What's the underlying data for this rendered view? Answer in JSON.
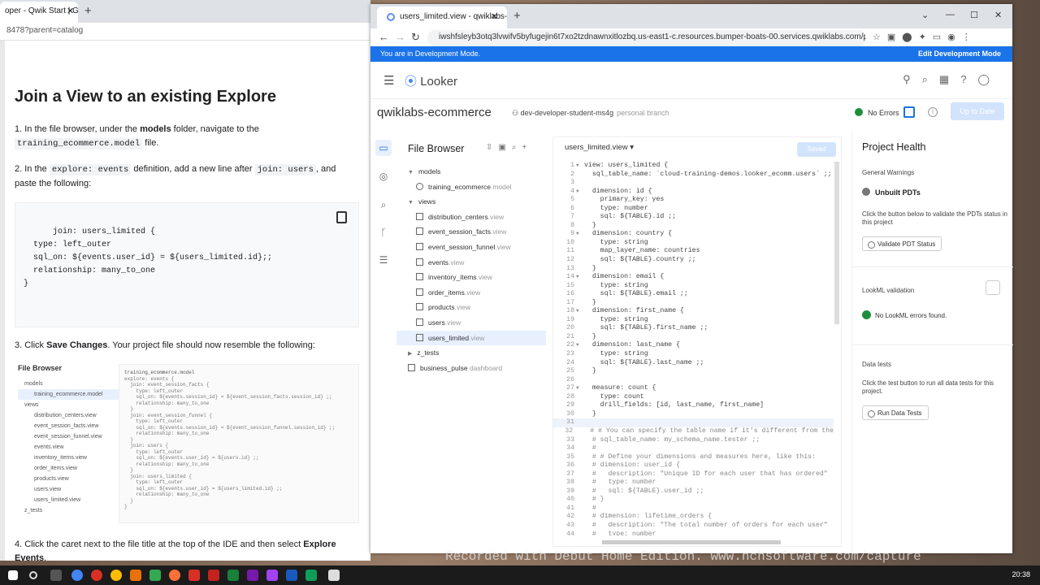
{
  "left_window": {
    "tab_title": "oper - Qwik Start | G",
    "url": "8478?parent=catalog",
    "heading": "Join a View to an existing Explore",
    "step1": {
      "a": "1. In the file browser, under the ",
      "b": "models",
      "c": " folder, navigate to the ",
      "code": "training_ecommerce.model",
      "d": " file."
    },
    "step2": {
      "a": "2. In the ",
      "code1": "explore: events",
      "b": " definition, add a new line after ",
      "code2": "join: users",
      "c": ", and paste the following:"
    },
    "code_block": "join: users_limited {\n  type: left_outer\n  sql_on: ${events.user_id} = ${users_limited.id};;\n  relationship: many_to_one\n}",
    "step3": {
      "a": "3. Click ",
      "b": "Save Changes",
      "c": ". Your project file should now resemble the following:"
    },
    "thumb": {
      "title": "File Browser",
      "file": "training_ecommerce.model",
      "items": [
        "models",
        "training_ecommerce.model",
        "views",
        "distribution_centers.view",
        "event_session_facts.view",
        "event_session_funnel.view",
        "events.view",
        "inventory_items.view",
        "order_items.view",
        "products.view",
        "users.view",
        "users_limited.view",
        "z_tests"
      ],
      "code": "explore: events {\n  join: event_session_facts {\n    type: left_outer\n    sql_on: ${events.session_id} = ${event_session_facts.session_id} ;;\n    relationship: many_to_one\n  }\n  join: event_session_funnel {\n    type: left_outer\n    sql_on: ${events.session_id} = ${event_session_funnel.session_id} ;;\n    relationship: many_to_one\n  }\n  join: users {\n    type: left_outer\n    sql_on: ${events.user_id} = ${users.id} ;;\n    relationship: many_to_one\n  }\n  join: users_limited {\n    type: left_outer\n    sql_on: ${events.user_id} = ${users_limited.id} ;;\n    relationship: many_to_one\n  }\n}"
    },
    "step4": {
      "a": "4. Click the caret next to the file title at the top of the IDE and then select ",
      "b": "Explore Events",
      "c": "."
    }
  },
  "right_window": {
    "tab_title": "users_limited.view - qwiklabs-ec",
    "url": "iwshfsleyb3otq3lvwifv5byfugejin6t7xo2tzdnawnxitlozbq.us-east1-c.resources.bumper-boats-00.services.qwiklabs.com/project...",
    "dev_mode": "You are in Development Mode.",
    "edit_dev_mode": "Edit Development Mode",
    "logo": "Looker",
    "project_name": "qwiklabs-ecommerce",
    "branch": "dev-developer-student-ms4g",
    "branch_type": "personal branch",
    "no_errors": "No Errors",
    "up_to_date": "Up to Date",
    "file_browser": {
      "title": "File Browser",
      "items": [
        {
          "label": "models",
          "ext": "",
          "kind": "folder",
          "indent": 1
        },
        {
          "label": "training_ecommerce",
          "ext": ".model",
          "kind": "model",
          "indent": 2
        },
        {
          "label": "views",
          "ext": "",
          "kind": "folder",
          "indent": 1
        },
        {
          "label": "distribution_centers",
          "ext": ".view",
          "kind": "view",
          "indent": 2
        },
        {
          "label": "event_session_facts",
          "ext": ".view",
          "kind": "view",
          "indent": 2
        },
        {
          "label": "event_session_funnel",
          "ext": ".view",
          "kind": "view",
          "indent": 2
        },
        {
          "label": "events",
          "ext": ".view",
          "kind": "view",
          "indent": 2
        },
        {
          "label": "inventory_items",
          "ext": ".view",
          "kind": "view",
          "indent": 2
        },
        {
          "label": "order_items",
          "ext": ".view",
          "kind": "view",
          "indent": 2
        },
        {
          "label": "products",
          "ext": ".view",
          "kind": "view",
          "indent": 2
        },
        {
          "label": "users",
          "ext": ".view",
          "kind": "view",
          "indent": 2
        },
        {
          "label": "users_limited",
          "ext": ".view",
          "kind": "view",
          "indent": 2,
          "selected": true
        },
        {
          "label": "z_tests",
          "ext": "",
          "kind": "folder-closed",
          "indent": 1
        },
        {
          "label": "business_pulse",
          "ext": " dashboard",
          "kind": "dash",
          "indent": 1
        }
      ]
    },
    "editor": {
      "file": "users_limited.view",
      "saved": "Saved",
      "lines": [
        "view: users_limited {",
        "  sql_table_name: `cloud-training-demos.looker_ecomm.users` ;;",
        "",
        "  dimension: id {",
        "    primary_key: yes",
        "    type: number",
        "    sql: ${TABLE}.id ;;",
        "  }",
        "  dimension: country {",
        "    type: string",
        "    map_layer_name: countries",
        "    sql: ${TABLE}.country ;;",
        "  }",
        "  dimension: email {",
        "    type: string",
        "    sql: ${TABLE}.email ;;",
        "  }",
        "  dimension: first_name {",
        "    type: string",
        "    sql: ${TABLE}.first_name ;;",
        "  }",
        "  dimension: last_name {",
        "    type: string",
        "    sql: ${TABLE}.last_name ;;",
        "  }",
        "",
        "  measure: count {",
        "    type: count",
        "    drill_fields: [id, last_name, first_name]",
        "  }",
        "",
        "  # # You can specify the table name if it's different from the",
        "  # sql_table_name: my_schema_name.tester ;;",
        "  #",
        "  # # Define your dimensions and measures here, like this:",
        "  # dimension: user_id {",
        "  #   description: \"Unique ID for each user that has ordered\"",
        "  #   type: number",
        "  #   sql: ${TABLE}.user_id ;;",
        "  # }",
        "  #",
        "  # dimension: lifetime_orders {",
        "  #   description: \"The total number of orders for each user\"",
        "  #   type: number"
      ]
    },
    "health": {
      "title": "Project Health",
      "general": "General Warnings",
      "unbuilt": "Unbuilt PDTs",
      "unbuilt_desc": "Click the button below to validate the PDTs status in this project",
      "validate_btn": "Validate PDT Status",
      "lookml": "LookML validation",
      "no_lookml_errors": "No LookML errors found.",
      "data_tests": "Data tests",
      "data_tests_desc": "Click the test button to run all data tests for this project.",
      "run_btn": "Run Data Tests"
    }
  },
  "watermark": "Recorded with Debut Home Edition. www.nchsoftware.com/capture",
  "taskbar": {
    "clock": "20:38"
  }
}
